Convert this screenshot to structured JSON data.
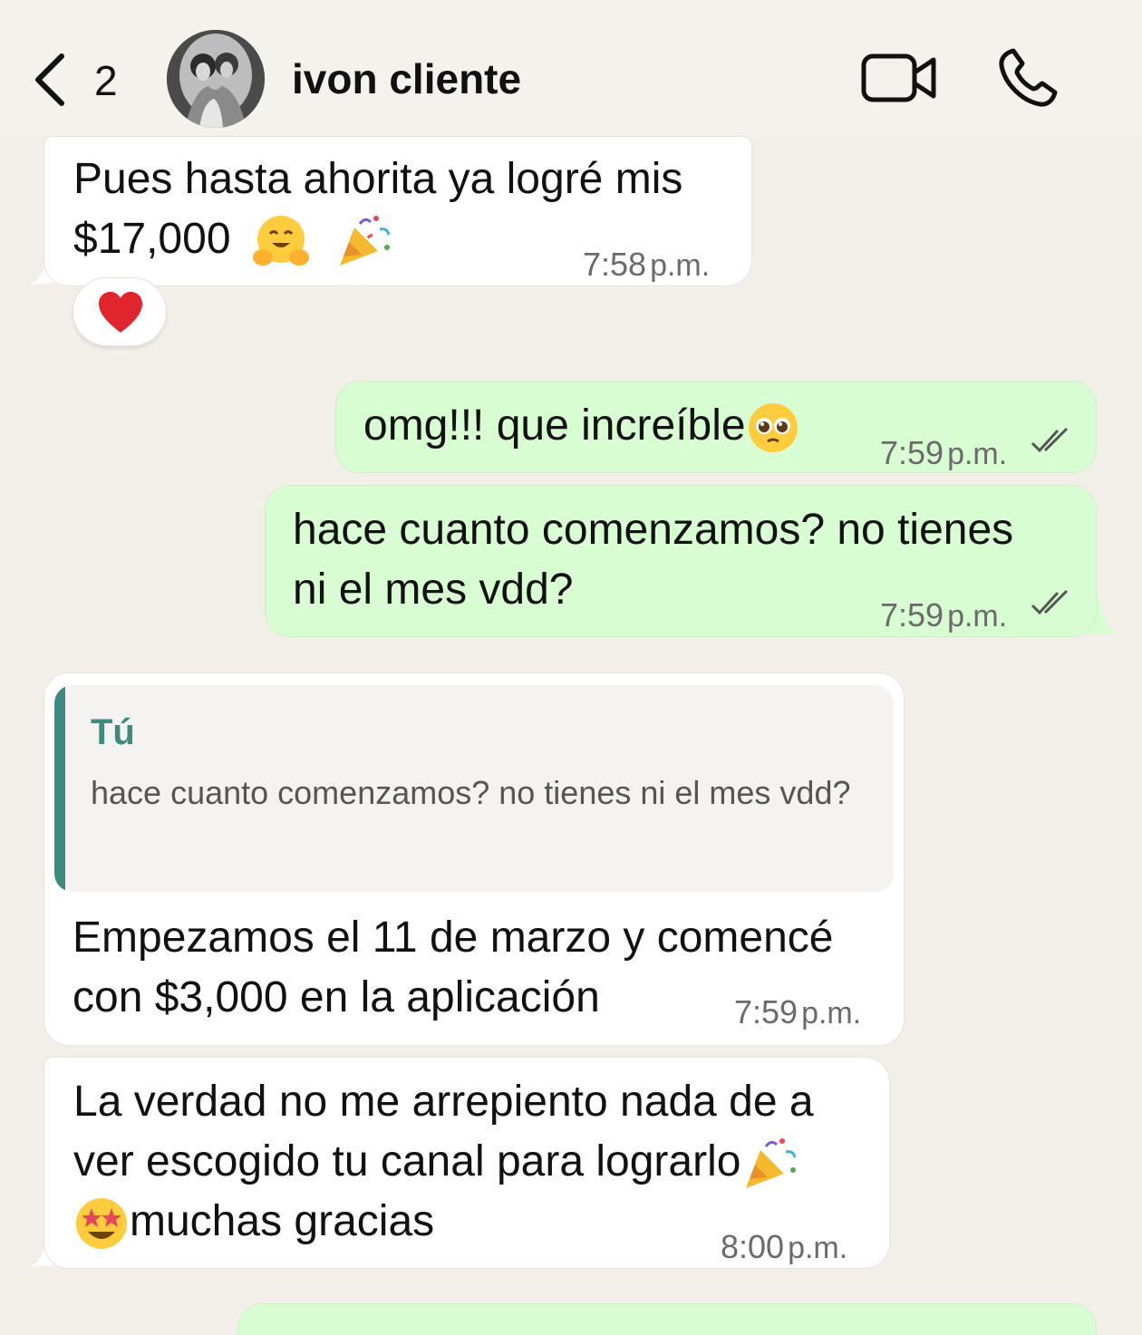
{
  "header": {
    "back_count": "2",
    "contact_name": "ivon cliente",
    "icons": [
      "chevron-left-icon",
      "video-camera-icon",
      "phone-icon"
    ]
  },
  "messages": [
    {
      "direction": "incoming",
      "lines": [
        "Pues hasta ahorita ya logré mis",
        "$17,000"
      ],
      "emojis": [
        "hugging-face",
        "party-popper"
      ],
      "time": "7:58",
      "time_suffix": "p.m.",
      "reaction": "red-heart"
    },
    {
      "direction": "outgoing",
      "lines": [
        "omg!!!  que increíble"
      ],
      "emojis": [
        "pleading-face"
      ],
      "time": "7:59",
      "time_suffix": "p.m.",
      "status": "read-double-check"
    },
    {
      "direction": "outgoing",
      "lines": [
        "hace cuanto comenzamos? no tienes",
        "ni el mes vdd?"
      ],
      "time": "7:59",
      "time_suffix": "p.m.",
      "status": "read-double-check"
    },
    {
      "direction": "incoming",
      "quote": {
        "author": "Tú",
        "text": "hace cuanto comenzamos? no tienes ni el mes vdd?"
      },
      "lines": [
        "Empezamos el 11 de marzo y comencé",
        "con $3,000 en la aplicación"
      ],
      "time": "7:59",
      "time_suffix": "p.m."
    },
    {
      "direction": "incoming",
      "lines": [
        "La verdad no me arrepiento nada de a",
        "ver escogido tu canal para lograrlo",
        "muchas gracias"
      ],
      "emojis": [
        "party-popper",
        "star-struck"
      ],
      "time": "8:00",
      "time_suffix": "p.m."
    }
  ],
  "colors": {
    "background": "#f2efe9",
    "incoming_bubble": "#ffffff",
    "outgoing_bubble": "#d9fdd3",
    "quote_accent": "#3f8a7e",
    "timestamp": "#6b6b6b"
  }
}
